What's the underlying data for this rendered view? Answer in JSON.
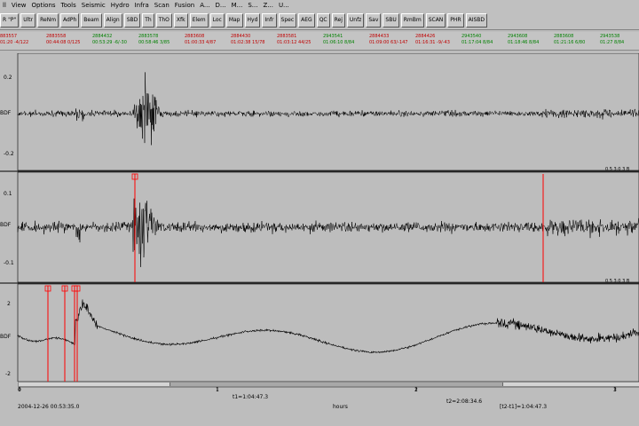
{
  "menu": [
    "ll",
    "View",
    "Options",
    "Tools",
    "Seismic",
    "Hydro",
    "Infra",
    "Scan",
    "Fusion",
    "A...",
    "D...",
    "M...",
    "S...",
    "Z...",
    "U..."
  ],
  "toolbar": [
    "R \"P\"",
    "Ultr",
    "ReNm",
    "AdPh",
    "Beam",
    "Align",
    "SBD",
    "Th",
    "ThO",
    "Xfk",
    "Elem",
    "Loc",
    "Map",
    "Hyd",
    "Infr",
    "Spec",
    "AEG",
    "QC",
    "Rej",
    "Unfz",
    "Sav",
    "SBU",
    "RmBm",
    "SCAN",
    "PHR",
    "AISBD"
  ],
  "origins": [
    {
      "id": "883557",
      "info": "01:20 -4/122",
      "color": "red"
    },
    {
      "id": "2883558",
      "info": "00:44:08 0/125",
      "color": "red"
    },
    {
      "id": "2884432",
      "info": "00:53:29 -6/-30",
      "color": "green"
    },
    {
      "id": "2883578",
      "info": "00:58:46 3/85",
      "color": "green"
    },
    {
      "id": "2883608",
      "info": "01:00:33 4/87",
      "color": "red"
    },
    {
      "id": "2884430",
      "info": "01:02:38 15/78",
      "color": "red"
    },
    {
      "id": "2883581",
      "info": "01:03:12 44/25",
      "color": "red"
    },
    {
      "id": "2943541",
      "info": "01:06:10 8/84",
      "color": "green"
    },
    {
      "id": "2884433",
      "info": "01:09:00 63/-147",
      "color": "red"
    },
    {
      "id": "2884426",
      "info": "01:16:31 -9/-43",
      "color": "red"
    },
    {
      "id": "2943540",
      "info": "01:17:04 8/84",
      "color": "green"
    },
    {
      "id": "2943608",
      "info": "01:18:46 8/84",
      "color": "green"
    },
    {
      "id": "2883608",
      "info": "01:21:16 6/80",
      "color": "green"
    },
    {
      "id": "2943538",
      "info": "01:27 8/84",
      "color": "green"
    }
  ],
  "panels": [
    {
      "channel": "BDF",
      "ytop": "0.2",
      "ybottom": "-0.2",
      "filter": "0.5   3.0   3 B"
    },
    {
      "channel": "BDF",
      "ytop": "0.1",
      "ybottom": "-0.1",
      "filter": "0.5   3.0   3 B"
    },
    {
      "channel": "BDF",
      "ytop": "2",
      "ybottom": "-2",
      "filter": ""
    }
  ],
  "axis": {
    "ticks": [
      "0",
      "1",
      "2",
      "3"
    ],
    "start_time": "2004-12-26 00:53:35.0",
    "unit": "hours",
    "t1": "t1=1:04:47.3",
    "t2": "t2=2:08:34.6",
    "dt": "[t2-t1]=1:04:47.3"
  },
  "colors": {
    "background": "#bdbdbd",
    "trace": "#000000",
    "pick": "#ff0000"
  }
}
